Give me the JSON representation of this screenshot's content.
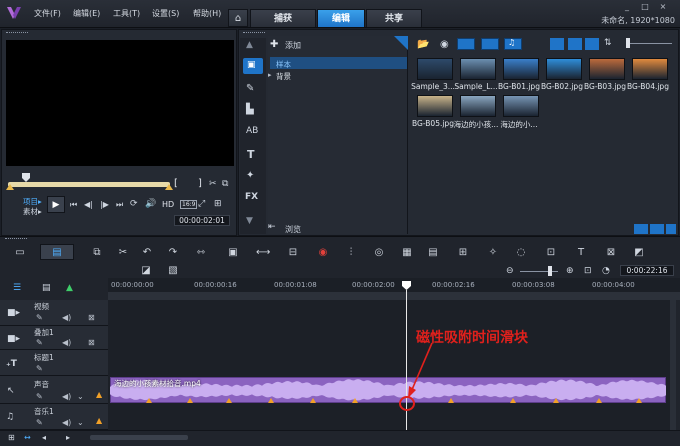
{
  "menu": {
    "items": [
      "文件(F)",
      "编辑(E)",
      "工具(T)",
      "设置(S)",
      "帮助(H)"
    ]
  },
  "tabs": {
    "home_icon": "home-icon",
    "capture": "捕获",
    "edit": "编辑",
    "share": "共享",
    "active": "edit"
  },
  "window": {
    "project_info": "未命名, 1920*1080",
    "controls": [
      "_",
      "□",
      "×"
    ]
  },
  "player": {
    "mode_labels": [
      "项目▸",
      "素材▸"
    ],
    "bracket_start": "[",
    "bracket_end": "]",
    "hd_label": "HD",
    "timecode": "00:00:02:01",
    "aspect_label": "16:9"
  },
  "library": {
    "add_label": "添加",
    "folders": [
      "样本",
      "背景"
    ],
    "browse_label": "浏览",
    "items": [
      {
        "label": "Sample_3...",
        "color": "#2e4a6a"
      },
      {
        "label": "Sample_L...",
        "color": "#6b8fb0"
      },
      {
        "label": "BG-B01.jpg",
        "color": "#3a7fc9"
      },
      {
        "label": "BG-B02.jpg",
        "color": "#2f8dd8"
      },
      {
        "label": "BG-B03.jpg",
        "color": "#bb6a3c"
      },
      {
        "label": "BG-B04.jpg",
        "color": "#e08a3e"
      },
      {
        "label": "BG-B05.jpg",
        "color": "#c8b38a"
      },
      {
        "label": "海边的小孩...",
        "color": "#8aa6c0"
      },
      {
        "label": "海边的小...",
        "color": "#7795b4"
      }
    ]
  },
  "timeline": {
    "timecode": "0:00:22:16",
    "ruler_labels": [
      "00:00:00:00",
      "00:00:00:16",
      "00:00:01:08",
      "00:00:02:00",
      "00:00:02:16",
      "00:00:03:08",
      "00:00:04:00"
    ],
    "tracks": [
      {
        "name": "视频",
        "icon": "video-track-icon"
      },
      {
        "name": "叠加1",
        "icon": "overlay-track-icon"
      },
      {
        "name": "标题1",
        "icon": "title-track-icon"
      },
      {
        "name": "声音",
        "icon": "voice-track-icon"
      },
      {
        "name": "音乐1",
        "icon": "music-track-icon"
      }
    ],
    "audio_clip_label": "海边的小孩素材拾音.mp4",
    "annotation": "磁性吸附时间滑块",
    "colors": {
      "audio_clip": "#8b63c0",
      "playhead": "#e8e8e8",
      "annotation": "#e0201c",
      "accent": "#2a86d6"
    }
  }
}
